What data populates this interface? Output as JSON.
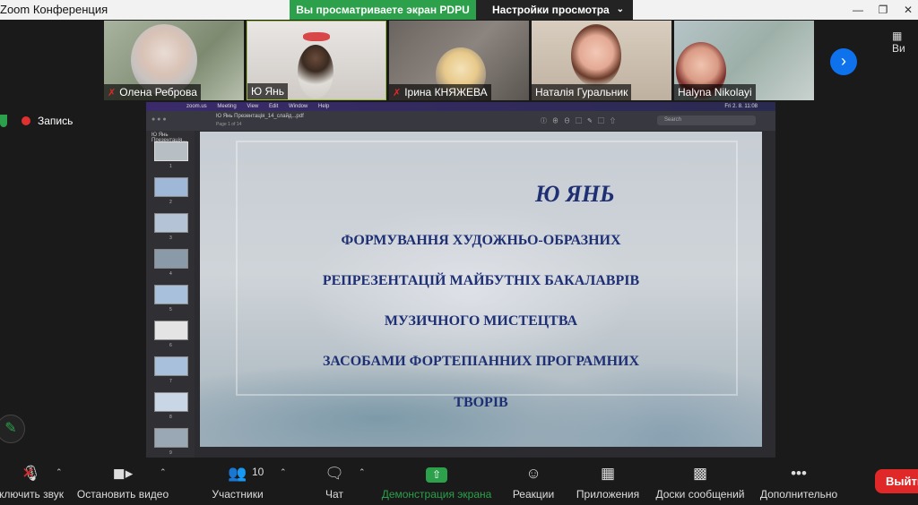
{
  "window": {
    "title": "Zoom Конференция",
    "share_banner": "Вы просматриваете экран PDPU",
    "view_options": "Настройки просмотра"
  },
  "participants": [
    {
      "name": "Олена Реброва",
      "muted": true
    },
    {
      "name": "Ю Янь",
      "muted": false
    },
    {
      "name": "Ірина КНЯЖЕВА",
      "muted": true
    },
    {
      "name": "Наталія Гуральник",
      "muted": false
    },
    {
      "name": "Halyna Nikolayi",
      "muted": false
    }
  ],
  "side_label": "Ви",
  "recording_label": "Запись",
  "shared_screen": {
    "menu": [
      "zoom.us",
      "Meeting",
      "View",
      "Edit",
      "Window",
      "Help"
    ],
    "clock": "Fri 2. 8. 11:08",
    "doc_title": "Ю Янь Презентація_14_слайд...pdf",
    "doc_page": "Page 1 of 14",
    "search_placeholder": "Search",
    "sidebar_header": "Ю Янь Презентація...",
    "page_numbers": [
      "1",
      "2",
      "3",
      "4",
      "5",
      "6",
      "7",
      "8",
      "9"
    ]
  },
  "slide": {
    "author": "Ю ЯНЬ",
    "lines": [
      "ФОРМУВАННЯ ХУДОЖНЬО-ОБРАЗНИХ",
      "РЕПРЕЗЕНТАЦІЙ МАЙБУТНІХ БАКАЛАВРІВ",
      "МУЗИЧНОГО МИСТЕЦТВА",
      "ЗАСОБАМИ ФОРТЕПІАННИХ ПРОГРАМНИХ",
      "ТВОРІВ"
    ]
  },
  "toolbar": {
    "unmute": "ключить звук",
    "stop_video": "Остановить видео",
    "participants": "Участники",
    "participants_count": "10",
    "chat": "Чат",
    "share_screen": "Демонстрация экрана",
    "reactions": "Реакции",
    "apps": "Приложения",
    "whiteboards": "Доски сообщений",
    "more": "Дополнительно",
    "leave": "Выйти"
  },
  "colors": {
    "accent_green": "#2ca04a",
    "leave_red": "#e02828",
    "blue_button": "#0e72ed",
    "slide_text": "#1e2f74"
  }
}
